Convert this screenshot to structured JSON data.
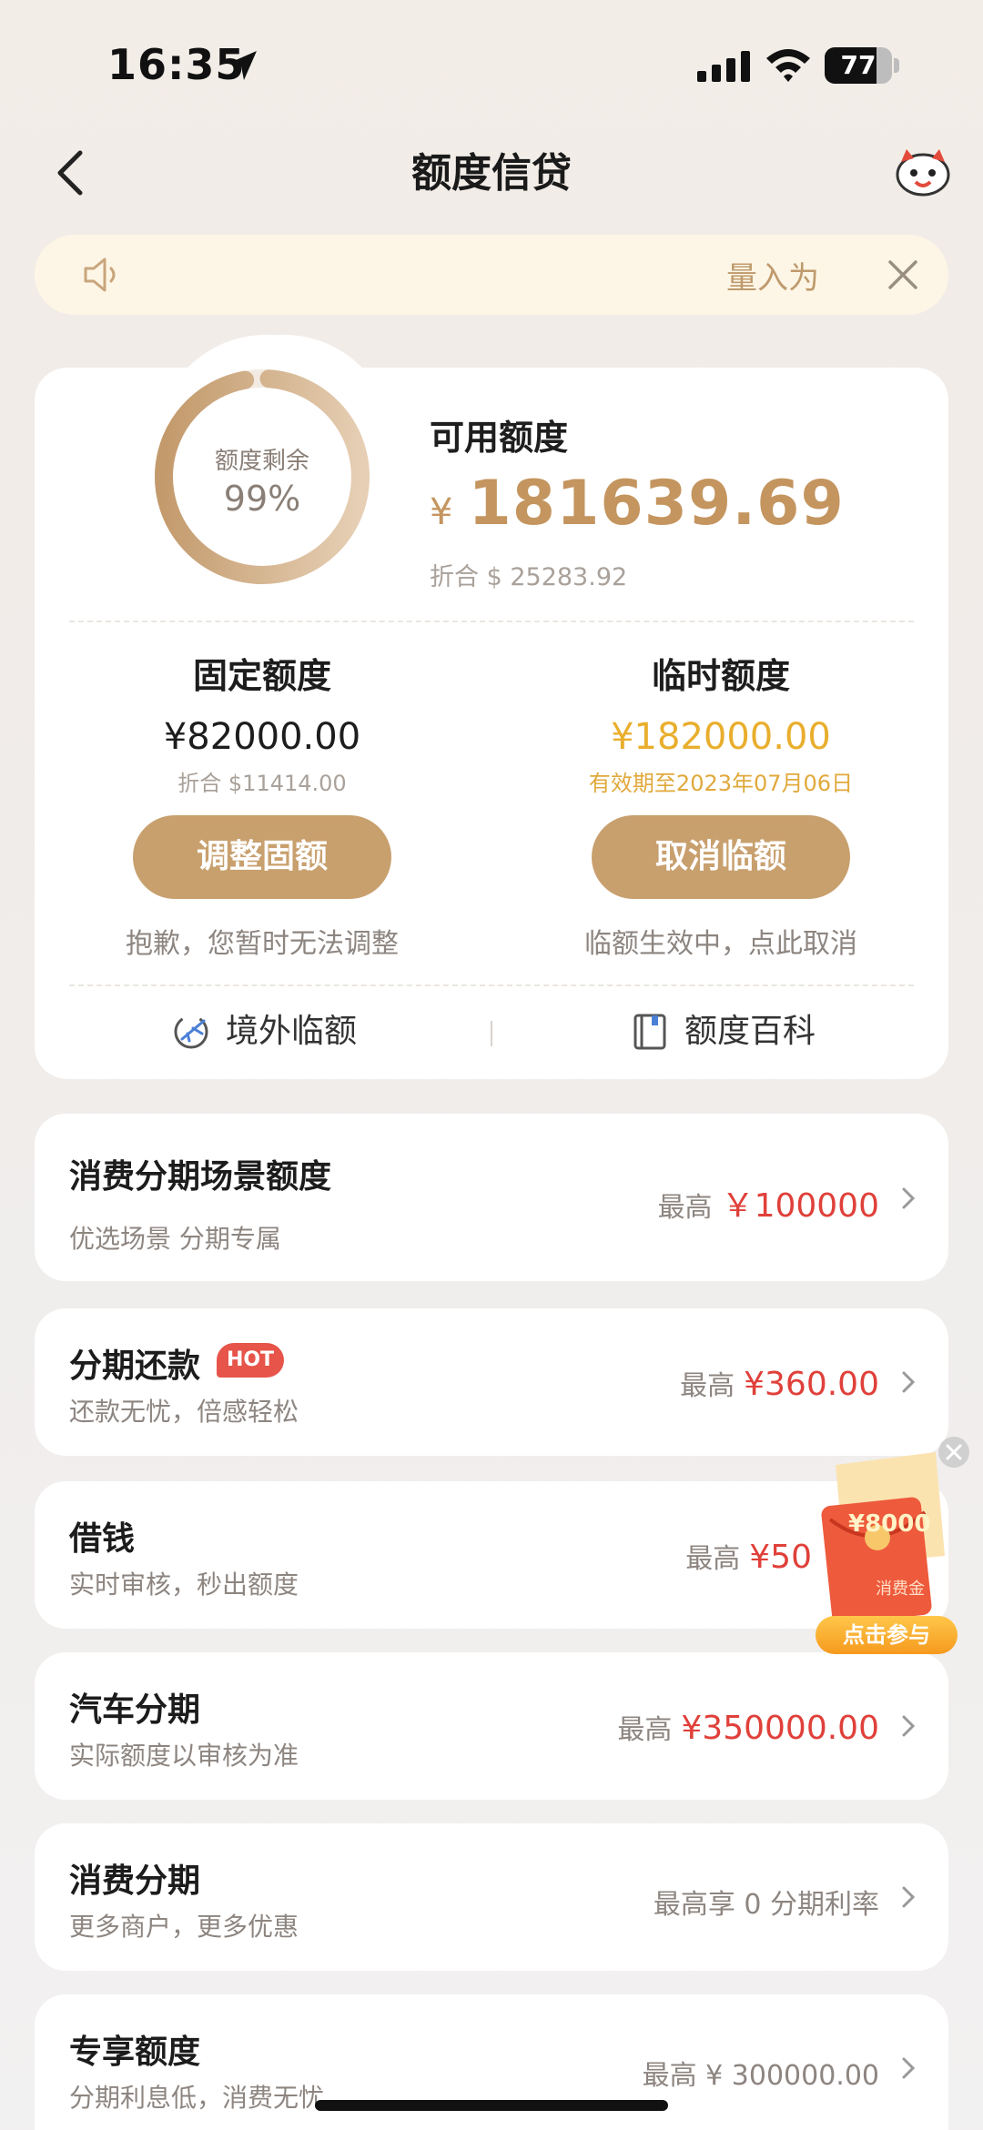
{
  "status_bar": {
    "time": "16:35",
    "battery": "77",
    "battery_level": 0.77
  },
  "nav": {
    "title": "额度信贷"
  },
  "notice": {
    "text": "量入为"
  },
  "credit_summary": {
    "ring_label": "额度剩余",
    "ring_value": "99%",
    "ring_fraction": 0.99,
    "available_title": "可用额度",
    "currency_symbol": "¥",
    "available_amount": "181639.69",
    "available_usd": "折合 $ 25283.92",
    "fixed": {
      "title": "固定额度",
      "amount": "¥82000.00",
      "usd": "折合 $11414.00",
      "button": "调整固额",
      "note": "抱歉，您暂时无法调整"
    },
    "temporary": {
      "title": "临时额度",
      "amount": "¥182000.00",
      "validity": "有效期至2023年07月06日",
      "button": "取消临额",
      "note": "临额生效中，点此取消"
    },
    "links": {
      "overseas": "境外临额",
      "wiki": "额度百科"
    }
  },
  "cards": [
    {
      "title": "消费分期场景额度",
      "subtitle": "优选场景 分期专属",
      "prefix": "最高",
      "amount": "￥100000"
    },
    {
      "title": "分期还款",
      "badge": "HOT",
      "subtitle": "还款无忧，倍感轻松",
      "prefix": "最高",
      "amount": "¥360.00"
    },
    {
      "title": "借钱",
      "subtitle": "实时审核，秒出额度",
      "prefix": "最高",
      "amount": "¥50"
    },
    {
      "title": "汽车分期",
      "subtitle": "实际额度以审核为准",
      "prefix": "最高",
      "amount": "¥350000.00"
    },
    {
      "title": "消费分期",
      "subtitle": "更多商户，更多优惠",
      "text": "最高享 0 分期利率"
    },
    {
      "title": "专享额度",
      "subtitle": "分期利息低，消费无忧",
      "text": "最高 ¥ 300000.00"
    }
  ],
  "promo": {
    "amount": "¥8000",
    "label": "消费金",
    "button": "点击参与"
  },
  "colors": {
    "gold": "#c8a06e",
    "red": "#e0403a",
    "amber": "#e9ae2d"
  }
}
